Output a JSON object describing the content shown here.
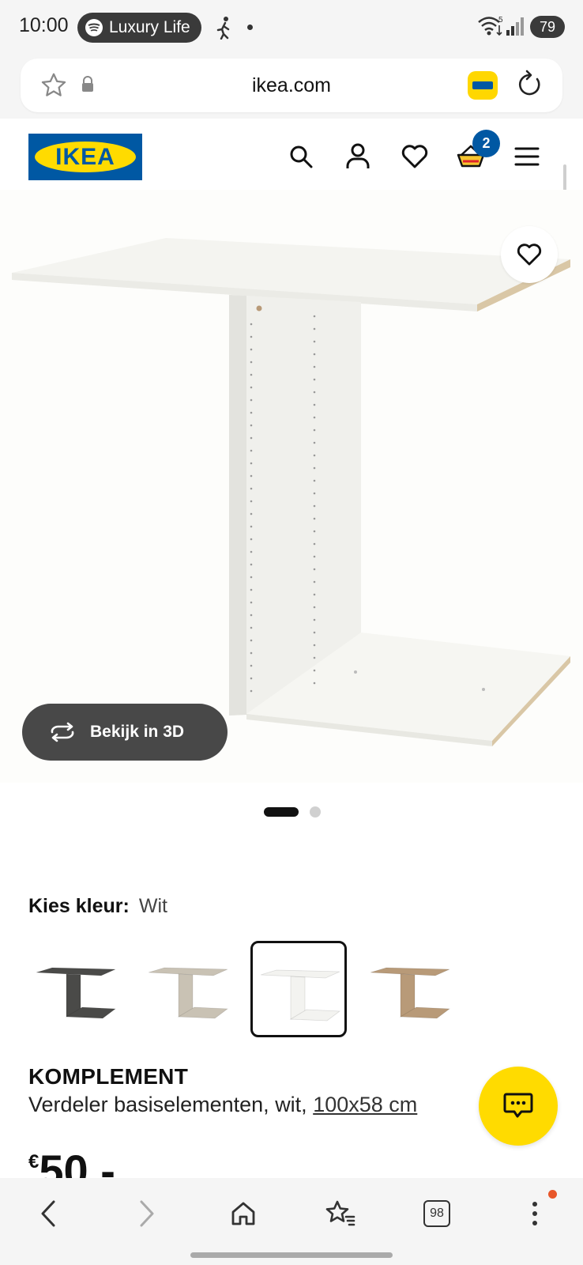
{
  "status_bar": {
    "time": "10:00",
    "media_pill": "Luxury Life",
    "wifi_label": "5",
    "battery": "79"
  },
  "browser": {
    "url": "ikea.com",
    "tab_count": "98"
  },
  "header": {
    "logo_text": "IKEA",
    "cart_count": "2"
  },
  "gallery": {
    "view_3d_label": "Bekijk in 3D",
    "page_count": 2,
    "active_page": 1
  },
  "color": {
    "label": "Kies kleur:",
    "selected": "Wit",
    "swatches": [
      {
        "name": "dark",
        "color": "#4a4a48"
      },
      {
        "name": "beige",
        "color": "#c9c2b4"
      },
      {
        "name": "white",
        "color": "#f3f3f0"
      },
      {
        "name": "oak",
        "color": "#b89a78"
      }
    ],
    "selected_index": 2
  },
  "product": {
    "name": "KOMPLEMENT",
    "description": "Verdeler basiselementen, wit,",
    "size": "100x58 cm",
    "currency": "€",
    "price": "50",
    "price_suffix": ",-"
  },
  "colors": {
    "ikea_blue": "#0058a3",
    "ikea_yellow": "#ffdb00",
    "dark_button": "#484848",
    "badge_red": "#e8572a"
  },
  "icons": {
    "status": [
      "spotify-icon",
      "walking-icon",
      "wifi-icon",
      "signal-icon",
      "battery-icon"
    ],
    "url_bar": [
      "star-icon",
      "lock-icon",
      "ikea-app-icon",
      "reload-icon"
    ],
    "header": [
      "search-icon",
      "account-icon",
      "heart-icon",
      "cart-icon",
      "hamburger-menu-icon"
    ],
    "bottom_nav": [
      "back-icon",
      "forward-icon",
      "home-icon",
      "bookmarks-icon",
      "tabs-icon",
      "more-vertical-icon"
    ]
  }
}
